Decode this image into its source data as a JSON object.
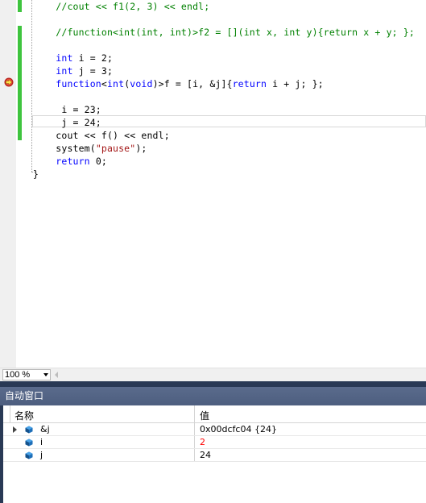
{
  "editor": {
    "code_lines": [
      {
        "segments": [
          {
            "t": "    ",
            "c": ""
          },
          {
            "t": "//cout << f1(2, 3) << endl;",
            "c": "cm"
          }
        ]
      },
      {
        "segments": []
      },
      {
        "segments": [
          {
            "t": "    ",
            "c": ""
          },
          {
            "t": "//function<int(int, int)>f2 = [](int x, int y){return x + y; };",
            "c": "cm"
          }
        ]
      },
      {
        "segments": []
      },
      {
        "segments": [
          {
            "t": "    ",
            "c": ""
          },
          {
            "t": "int",
            "c": "kw"
          },
          {
            "t": " i = 2;",
            "c": ""
          }
        ]
      },
      {
        "segments": [
          {
            "t": "    ",
            "c": ""
          },
          {
            "t": "int",
            "c": "kw"
          },
          {
            "t": " j = 3;",
            "c": ""
          }
        ]
      },
      {
        "segments": [
          {
            "t": "    ",
            "c": ""
          },
          {
            "t": "function",
            "c": "kw"
          },
          {
            "t": "<",
            "c": ""
          },
          {
            "t": "int",
            "c": "kw"
          },
          {
            "t": "(",
            "c": ""
          },
          {
            "t": "void",
            "c": "kw"
          },
          {
            "t": ")>f = [i, &j]{",
            "c": ""
          },
          {
            "t": "return",
            "c": "kw"
          },
          {
            "t": " i + j; };",
            "c": ""
          }
        ]
      },
      {
        "segments": []
      },
      {
        "segments": [
          {
            "t": "     i = 23;",
            "c": ""
          }
        ]
      },
      {
        "segments": [
          {
            "t": "     j = 24;",
            "c": ""
          }
        ]
      },
      {
        "segments": [
          {
            "t": "    cout << f() << endl;",
            "c": ""
          }
        ]
      },
      {
        "segments": [
          {
            "t": "    system(",
            "c": ""
          },
          {
            "t": "\"pause\"",
            "c": "st"
          },
          {
            "t": ");",
            "c": ""
          }
        ]
      },
      {
        "segments": [
          {
            "t": "    ",
            "c": ""
          },
          {
            "t": "return",
            "c": "kw"
          },
          {
            "t": " 0;",
            "c": ""
          }
        ]
      },
      {
        "segments": [
          {
            "t": "}",
            "c": ""
          }
        ]
      }
    ],
    "breakpoint_icon": "current-statement-arrow-icon"
  },
  "zoom": {
    "value": "100 %"
  },
  "autos_window": {
    "title": "自动窗口",
    "columns": {
      "name": "名称",
      "value": "值"
    },
    "rows": [
      {
        "name": "&j",
        "value": "0x00dcfc04 {24}",
        "expandable": true,
        "changed": false
      },
      {
        "name": "i",
        "value": "2",
        "expandable": false,
        "changed": true
      },
      {
        "name": "j",
        "value": "24",
        "expandable": false,
        "changed": false
      }
    ]
  },
  "colors": {
    "keyword": "#0000ff",
    "comment": "#008000",
    "string": "#a31515",
    "change_bar": "#3ec43e",
    "changed_value": "#ff0000",
    "tool_window_frame": "#293955"
  }
}
